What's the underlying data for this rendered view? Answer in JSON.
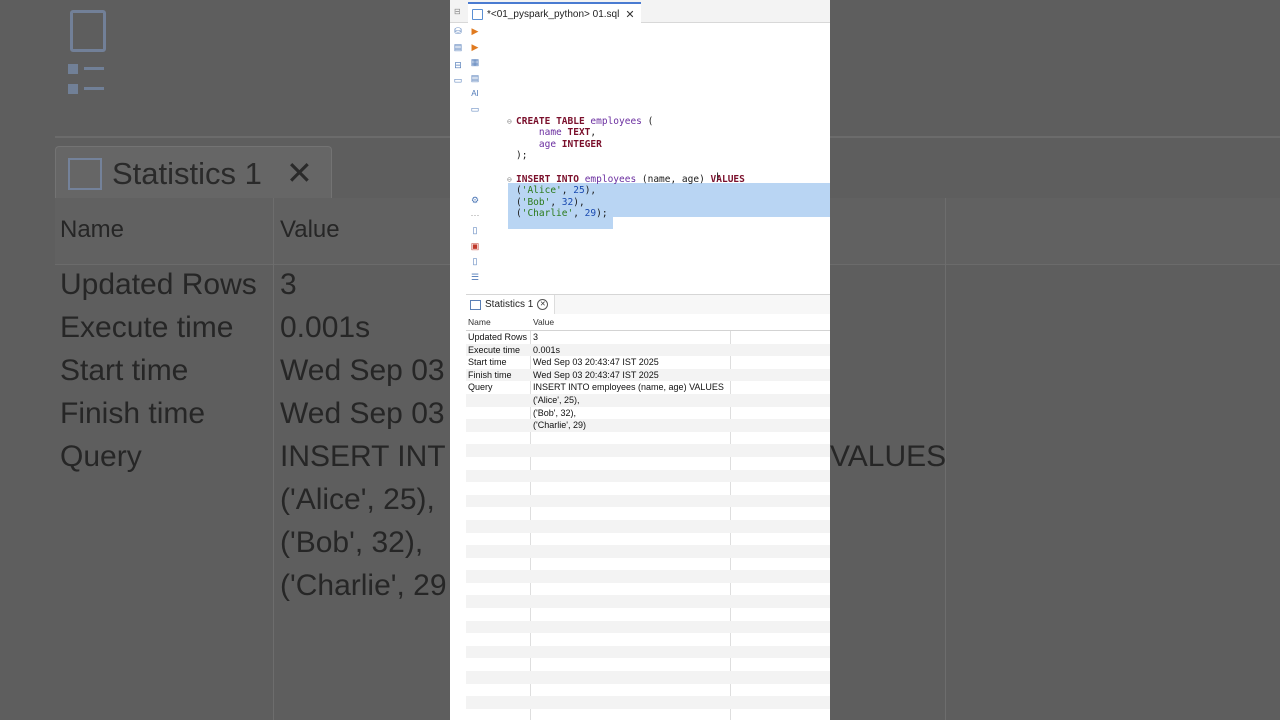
{
  "editor_tab": {
    "title": "*<01_pyspark_python> 01.sql",
    "close_glyph": "✕"
  },
  "editor": {
    "create": {
      "kw1": "CREATE",
      "kw2": "TABLE",
      "table": "employees",
      "open": " ("
    },
    "col1": {
      "name": "name",
      "type": "TEXT",
      "sep": ","
    },
    "col2": {
      "name": "age",
      "type": "INTEGER"
    },
    "close": ");",
    "insert": {
      "kw1": "INSERT",
      "kw2": "INTO",
      "table": "employees",
      "cols": " (name, age) ",
      "kw3": "VALUES"
    },
    "v1": {
      "s": "'Alice'",
      "n": "25",
      "tail": "),"
    },
    "v2": {
      "s": "'Bob'",
      "n": "32",
      "tail": "),"
    },
    "v3": {
      "s": "'Charlie'",
      "n": "29",
      "tail": ");"
    }
  },
  "results": {
    "tab_label": "Statistics 1",
    "headers": {
      "name": "Name",
      "value": "Value"
    },
    "rows": [
      {
        "name": "Updated Rows",
        "value": "3"
      },
      {
        "name": "Execute time",
        "value": "0.001s"
      },
      {
        "name": "Start time",
        "value": "Wed Sep 03 20:43:47 IST 2025"
      },
      {
        "name": "Finish time",
        "value": "Wed Sep 03 20:43:47 IST 2025"
      },
      {
        "name": "Query",
        "value": "INSERT INTO employees (name, age) VALUES"
      },
      {
        "name": "",
        "value": "('Alice', 25),"
      },
      {
        "name": "",
        "value": "('Bob', 32),"
      },
      {
        "name": "",
        "value": "('Charlie', 29)"
      }
    ]
  },
  "background": {
    "tab_label": "Statistics 1",
    "header_name": "Name",
    "header_value": "Value",
    "rows": [
      {
        "name": "Updated Rows",
        "value": "3"
      },
      {
        "name": "Execute time",
        "value": "0.001s"
      },
      {
        "name": "Start time",
        "value": "Wed Sep 03"
      },
      {
        "name": "Finish time",
        "value": "Wed Sep 03"
      },
      {
        "name": "Query",
        "value": "INSERT INT"
      }
    ],
    "extra": [
      "('Alice', 25),",
      "('Bob', 32),",
      "('Charlie', 29"
    ],
    "values_right": "VALUES"
  },
  "icons": {
    "run": "run-icon",
    "run_script": "run-script-icon",
    "explain": "explain-plan-icon",
    "format": "format-icon",
    "ai": "ai-assistant-icon",
    "settings": "gear-icon"
  },
  "colors": {
    "accent": "#4a7bd1",
    "selection": "#b9d5f3",
    "keyword": "#7a0f2b",
    "identifier": "#6b2fa0",
    "string": "#2b7a1a",
    "number": "#1a4ab0"
  }
}
